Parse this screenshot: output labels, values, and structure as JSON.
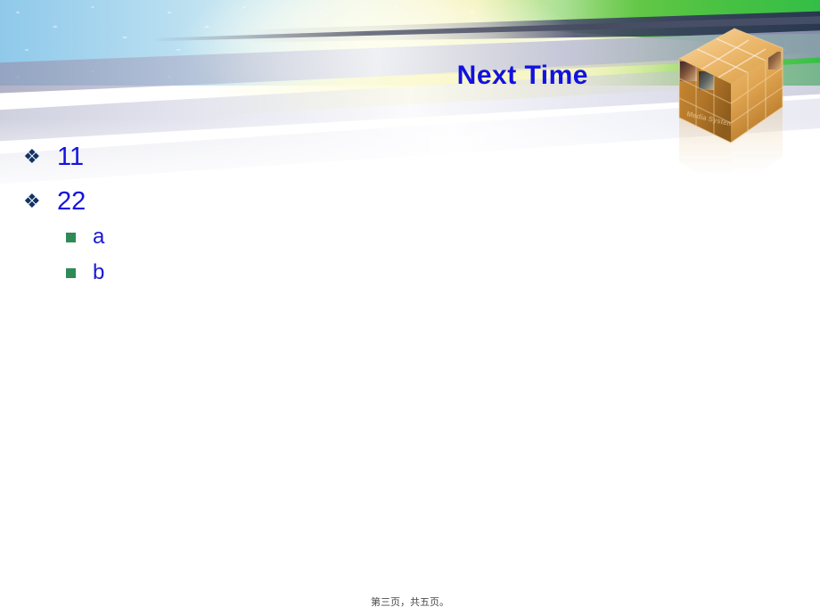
{
  "slide": {
    "title": "Next Time",
    "title_color": "#1212E0",
    "background_color": "#FFFFFF"
  },
  "banner": {
    "graphic_name": "golden-photo-cube",
    "colors": {
      "sky_left": "#8FC9EA",
      "sky_center": "#F6F3C4",
      "sky_right": "#35BF46",
      "band_lavender": "#B2B4CD",
      "band_dark_slate": "#4A4E70",
      "cube_gold": "#D79A3C",
      "cube_gold_light": "#F2C37A",
      "cube_gold_dark": "#9B6420"
    },
    "cube_face_label": "Media System"
  },
  "content": {
    "bullets": [
      {
        "marker": "diamond-cluster",
        "text": "11",
        "children": []
      },
      {
        "marker": "diamond-cluster",
        "text": "22",
        "children": [
          {
            "marker": "green-square",
            "text": "a"
          },
          {
            "marker": "green-square",
            "text": "b"
          }
        ]
      }
    ],
    "bullet_glyph": "❖",
    "sub_bullet_color": "#2E8B57",
    "text_color": "#1414DC"
  },
  "footer": {
    "text": "第三页，共五页。"
  }
}
